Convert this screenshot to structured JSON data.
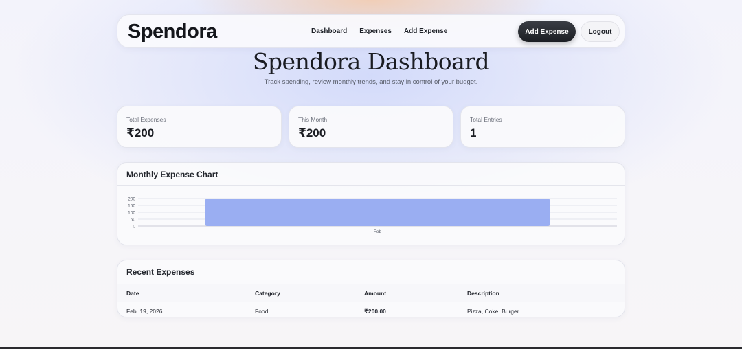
{
  "nav": {
    "brand": "Spendora",
    "links": [
      "Dashboard",
      "Expenses",
      "Add Expense"
    ],
    "add_button": "Add Expense",
    "logout_button": "Logout"
  },
  "hero": {
    "title": "Spendora Dashboard",
    "subtitle": "Track spending, review monthly trends, and stay in control of your budget."
  },
  "stats": [
    {
      "label": "Total Expenses",
      "value": "₹200"
    },
    {
      "label": "This Month",
      "value": "₹200"
    },
    {
      "label": "Total Entries",
      "value": "1"
    }
  ],
  "chart_section": {
    "title": "Monthly Expense Chart"
  },
  "chart_data": {
    "type": "bar",
    "categories": [
      "Feb"
    ],
    "values": [
      200
    ],
    "ylim": [
      0,
      200
    ],
    "yticks": [
      0,
      50,
      100,
      150,
      200
    ],
    "title": "",
    "xlabel": "",
    "ylabel": "",
    "grid": true,
    "bar_color": "#9aaef2"
  },
  "recent": {
    "title": "Recent Expenses",
    "columns": [
      "Date",
      "Category",
      "Amount",
      "Description"
    ],
    "rows": [
      {
        "date": "Feb. 19, 2026",
        "category": "Food",
        "amount": "₹200.00",
        "description": "Pizza, Coke, Burger"
      }
    ]
  }
}
